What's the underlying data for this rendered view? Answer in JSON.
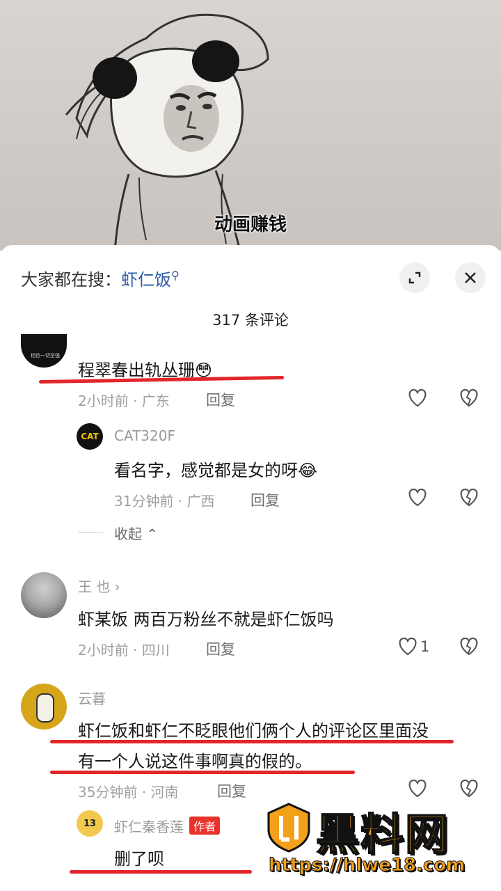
{
  "video": {
    "caption": "动画赚钱"
  },
  "header": {
    "search_prefix": "大家都在搜：",
    "search_keyword": "虾仁饭",
    "comment_count": "317 条评论"
  },
  "comments": [
    {
      "text": "程翠春出轨丛珊",
      "emoji": "😳",
      "meta": "2小时前 · 广东",
      "reply": "回复",
      "avatar_text": "相信一切坚强"
    },
    {
      "user": "CAT320F",
      "text": "看名字，感觉都是女的呀",
      "emoji": "😂",
      "meta": "31分钟前 · 广西",
      "reply": "回复",
      "avatar_text": "CAT"
    },
    {
      "collapse": "收起"
    },
    {
      "user": "王 也",
      "text": "虾某饭 两百万粉丝不就是虾仁饭吗",
      "meta": "2小时前 · 四川",
      "reply": "回复",
      "likes": "1"
    },
    {
      "user": "云暮",
      "text_line1": "虾仁饭和虾仁不眨眼他们俩个人的评论区里面没",
      "text_line2": "有一个人说这件事啊真的假的。",
      "meta": "35分钟前 · 河南",
      "reply": "回复"
    },
    {
      "user": "虾仁秦香莲",
      "tag": "作者",
      "text": "删了呗",
      "avatar_text": "13"
    }
  ],
  "watermark": {
    "brand": "黑料网",
    "url": "https://hlwe18.com"
  },
  "colors": {
    "accent_red": "#e2262b",
    "link_blue": "#2a5aa8",
    "watermark_orange": "#f3a01a"
  }
}
